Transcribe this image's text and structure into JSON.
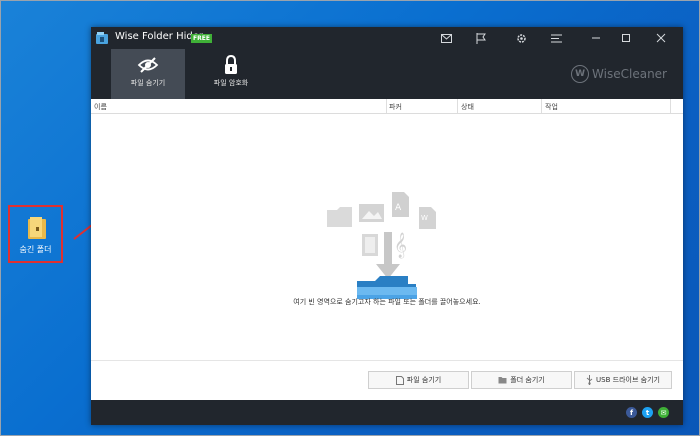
{
  "desktop": {
    "icon_label": "숨긴 폴더",
    "highlight_color": "#e03030"
  },
  "window": {
    "title": "Wise Folder Hider",
    "badge": "FREE",
    "titlebar_icons": [
      "mail-icon",
      "flag-icon",
      "settings-icon",
      "menu-icon",
      "minimize-icon",
      "maximize-icon",
      "close-icon"
    ],
    "tabs": [
      {
        "label": "파일 숨기기",
        "icon": "eye-slash-icon",
        "active": true
      },
      {
        "label": "파일 암호화",
        "icon": "lock-icon",
        "active": false
      }
    ],
    "brand": "WiseCleaner",
    "columns": [
      "이름",
      "파커",
      "상태",
      "작업"
    ],
    "hint": "여기 빈 영역으로 숨기고자 하는 파일 또는 폴더를 끌어놓으세요.",
    "buttons": [
      {
        "label": "파일 숨기기",
        "icon": "file-icon"
      },
      {
        "label": "폴더 숨기기",
        "icon": "folder-icon"
      },
      {
        "label": "USB 드라이브 숨기기",
        "icon": "usb-icon"
      }
    ],
    "social": [
      {
        "name": "facebook-icon",
        "glyph": "f",
        "color": "#3b5998"
      },
      {
        "name": "twitter-icon",
        "glyph": "t",
        "color": "#1da1f2"
      },
      {
        "name": "message-icon",
        "glyph": "✉",
        "color": "#3fb037"
      }
    ]
  }
}
